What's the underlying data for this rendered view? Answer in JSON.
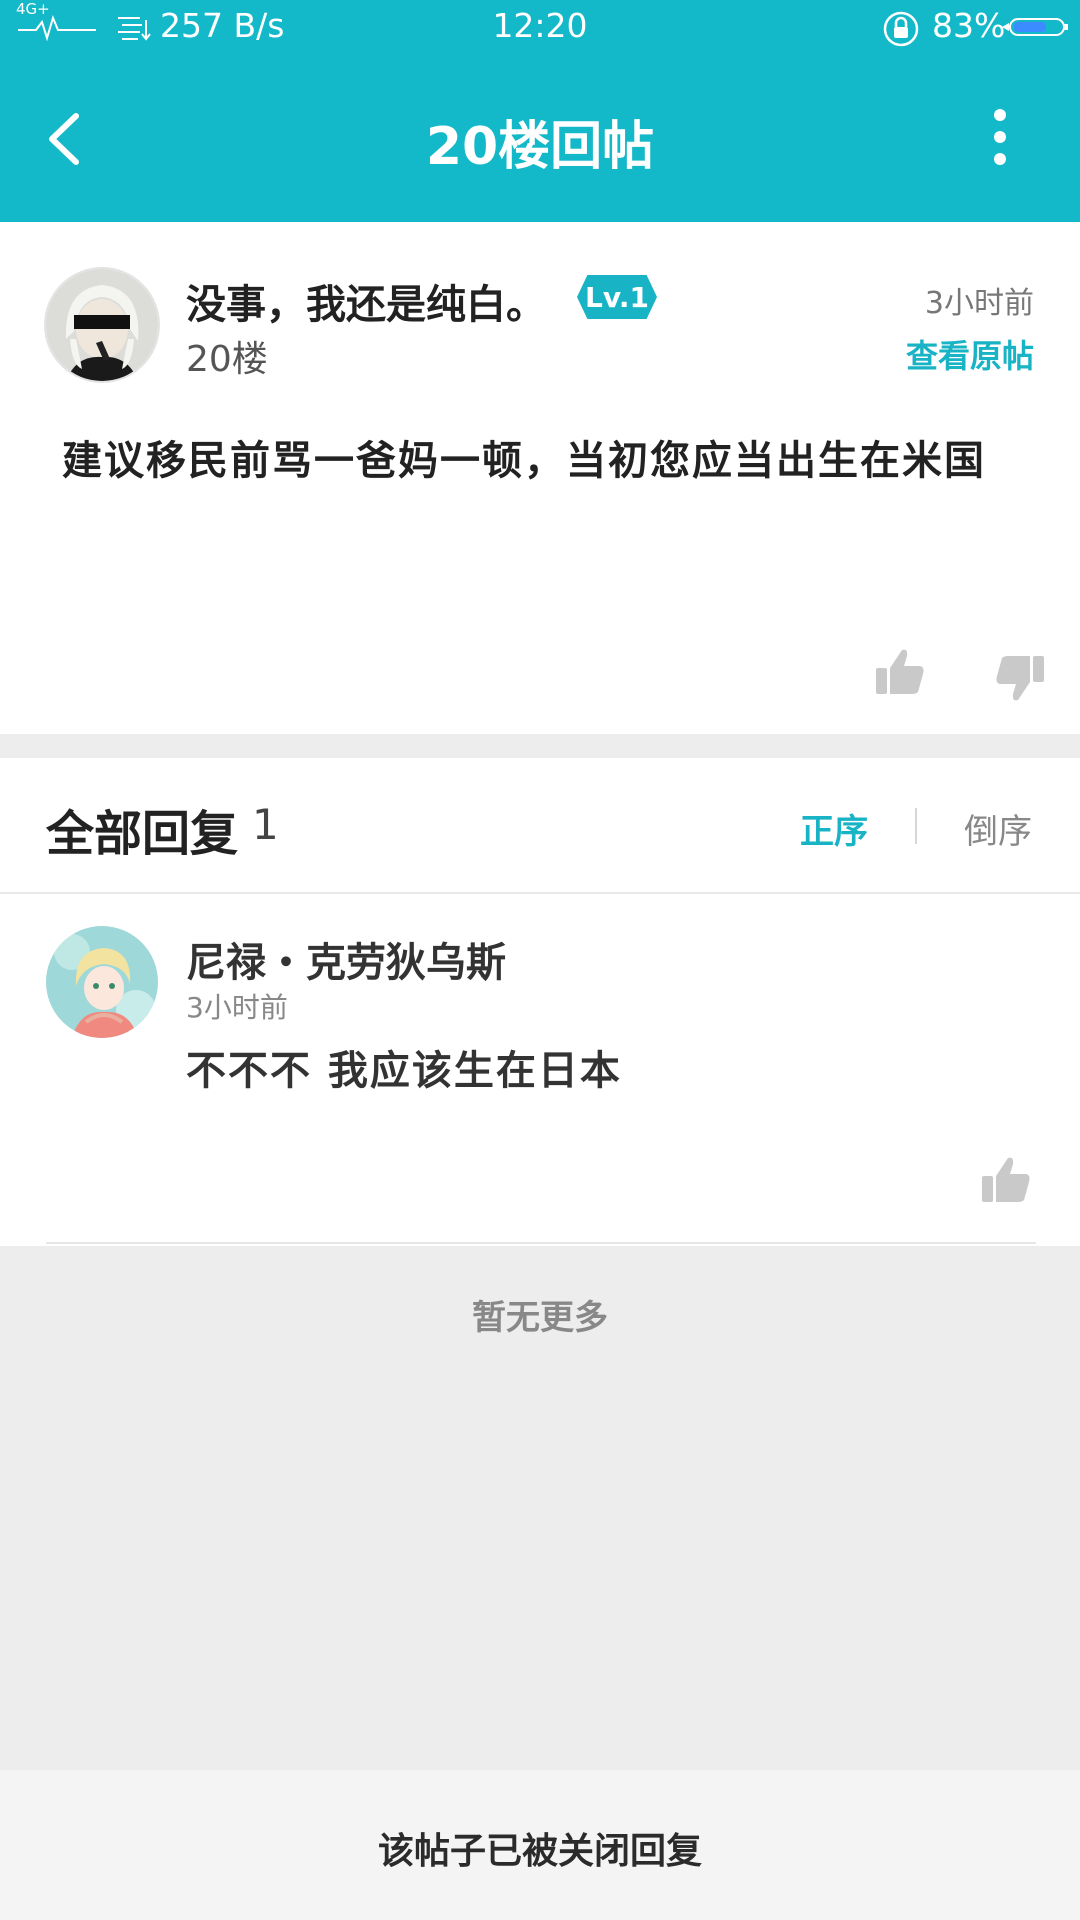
{
  "status_bar": {
    "network": "4G+",
    "speed": "257 B/s",
    "time": "12:20",
    "battery": "83%"
  },
  "header": {
    "title": "20楼回帖"
  },
  "post": {
    "author": "没事，我还是纯白。",
    "level": "Lv.1",
    "floor": "20楼",
    "time": "3小时前",
    "view_original": "查看原帖",
    "content": "建议移民前骂一爸妈一顿，当初您应当出生在米国"
  },
  "replies": {
    "title": "全部回复",
    "count": "1",
    "sort_asc": "正序",
    "sort_desc": "倒序",
    "items": [
      {
        "author": "尼禄・克劳狄乌斯",
        "time": "3小时前",
        "content": "不不不 我应该生在日本"
      }
    ]
  },
  "no_more": "暂无更多",
  "footer": {
    "closed": "该帖子已被关闭回复"
  },
  "colors": {
    "brand": "#14b9c9",
    "accent_text": "#19b3c6",
    "background": "#ededed"
  }
}
